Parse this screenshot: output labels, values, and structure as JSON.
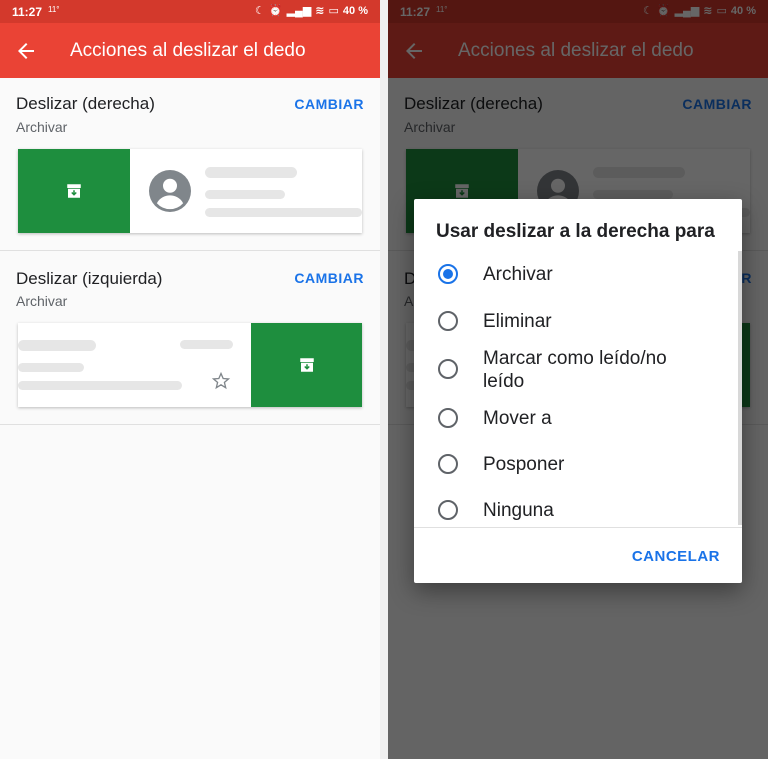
{
  "status": {
    "time": "11:27",
    "temp": "11°",
    "battery": "40 %"
  },
  "appbar": {
    "title": "Acciones al deslizar el dedo"
  },
  "swipe_right": {
    "title": "Deslizar (derecha)",
    "value": "Archivar",
    "action": "CAMBIAR"
  },
  "swipe_left": {
    "title": "Deslizar (izquierda)",
    "value": "Archivar",
    "action": "CAMBIAR"
  },
  "dialog": {
    "title": "Usar deslizar a la derecha para",
    "options": [
      {
        "label": "Archivar",
        "selected": true
      },
      {
        "label": "Eliminar",
        "selected": false
      },
      {
        "label": "Marcar como leído/no leído",
        "selected": false
      },
      {
        "label": "Mover a",
        "selected": false
      },
      {
        "label": "Posponer",
        "selected": false
      },
      {
        "label": "Ninguna",
        "selected": false
      }
    ],
    "cancel": "CANCELAR"
  },
  "colors": {
    "statusbar": "#d3392c",
    "appbar": "#ea4335",
    "swipe_green": "#1e8e3e",
    "accent": "#1a73e8"
  },
  "icons": {
    "back": "arrow-left-icon",
    "archive": "archive-icon",
    "avatar": "account-circle-icon",
    "star": "star-outline-icon"
  }
}
